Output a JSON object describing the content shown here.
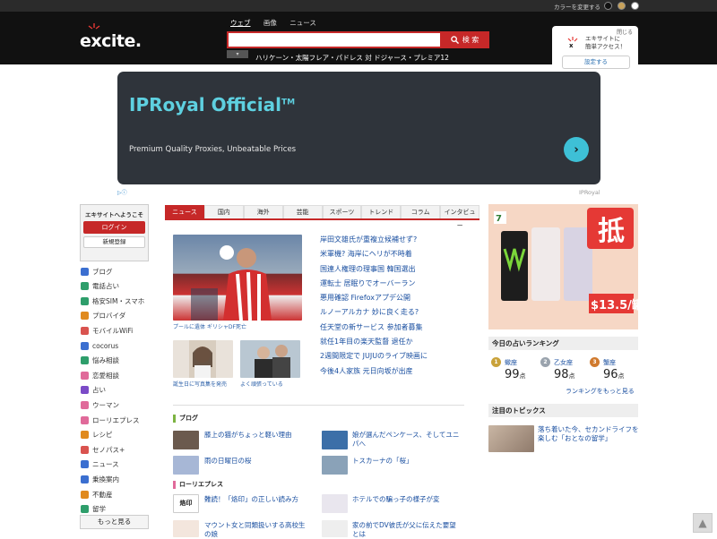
{
  "topbar": {
    "color_label": "カラーを変更する"
  },
  "header": {
    "logo": "excite.",
    "tabs": [
      "ウェブ",
      "画像",
      "ニュース"
    ],
    "search_value": "",
    "search_button": "検 索",
    "trending": "ハリケーン・太陽フレア・パドレス 対 ドジャース・プレミア12"
  },
  "promo": {
    "close": "閉じる",
    "line1": "エキサイトに",
    "line2": "簡単アクセス！",
    "button": "設定する"
  },
  "ad": {
    "title": "IPRoyal Official",
    "tm": "TM",
    "subtitle": "Premium Quality Proxies, Unbeatable Prices",
    "brand": "IPRoyal"
  },
  "sidebar": {
    "welcome": "エキサイトへようこそ",
    "login": "ログイン",
    "register": "新規登録",
    "items": [
      {
        "label": "ブログ",
        "color": "#3b6fd0"
      },
      {
        "label": "電話占い",
        "color": "#2e9e6b"
      },
      {
        "label": "格安SIM・スマホ",
        "color": "#2e9e6b"
      },
      {
        "label": "プロバイダ",
        "color": "#e08a1e"
      },
      {
        "label": "モバイルWiFi",
        "color": "#d9534f"
      },
      {
        "label": "cocorus",
        "color": "#3b6fd0"
      },
      {
        "label": "悩み相談",
        "color": "#2e9e6b"
      },
      {
        "label": "恋愛相談",
        "color": "#e06a9a"
      },
      {
        "label": "占い",
        "color": "#7b4bc7"
      },
      {
        "label": "ウーマン",
        "color": "#e06a9a"
      },
      {
        "label": "ローリエプレス",
        "color": "#e06a9a"
      },
      {
        "label": "レシピ",
        "color": "#e08a1e"
      },
      {
        "label": "セノパス+",
        "color": "#d9534f"
      },
      {
        "label": "ニュース",
        "color": "#3b6fd0"
      },
      {
        "label": "乗換案内",
        "color": "#3b6fd0"
      },
      {
        "label": "不動産",
        "color": "#e08a1e"
      },
      {
        "label": "留学",
        "color": "#2e9e6b"
      }
    ],
    "more": "もっと見る"
  },
  "news": {
    "categories": [
      "ニュース",
      "国内",
      "海外",
      "芸能",
      "スポーツ",
      "トレンド",
      "コラム",
      "インタビュー"
    ],
    "main_caption": "プールに遺体 ギリシャDF死亡",
    "sub_caption1": "誕生日に写真集を発売",
    "sub_caption2": "よく頑張っている",
    "headlines": [
      "岸田文雄氏が重複立候補せず?",
      "米軍機? 海岸にヘリが不時着",
      "国連人権理の理事国 韓国選出",
      "運転士 居眠りでオーバーラン",
      "悪用確認 Firefoxアプデ公開",
      "ルノーアルカナ 妙に良く走る?",
      "任天堂の新サービス 参加者募集",
      "就任1年目の楽天監督 退任か",
      "2週間限定で JUJUのライブ映画に",
      "今後4人家族 元日向坂が出産"
    ]
  },
  "blog": {
    "title": "ブログ",
    "items": [
      "膝上の猫がちょっと軽い理由",
      "娘が選んだペンケース、そしてユニパへ",
      "雨の日曜日の桜",
      "トスカーナの「桜」"
    ]
  },
  "laurier": {
    "title": "ローリエプレス",
    "items": [
      "難読！「烙印」の正しい読み方",
      "ホテルでの騙っ子の様子が変",
      "マウント女と同類扱いする高校生の娘",
      "家の前でDV彼氏が父に伝えた要望とは"
    ],
    "thumb_text": "烙印"
  },
  "right": {
    "ad_price": "$13.5/罐",
    "ad_big": "抵",
    "ranking_title": "今日の占いランキング",
    "ranking": [
      {
        "sign": "蠍座",
        "score": "99",
        "unit": "点",
        "rank": "1",
        "color": "#c9a23a"
      },
      {
        "sign": "乙女座",
        "score": "98",
        "unit": "点",
        "rank": "2",
        "color": "#9aa3ad"
      },
      {
        "sign": "蟹座",
        "score": "96",
        "unit": "点",
        "rank": "3",
        "color": "#d07a2e"
      }
    ],
    "ranking_more": "ランキングをもっと見る",
    "topics_title": "注目のトピックス",
    "topic_text": "落ち着いた今、セカンドライフを楽しむ「おとなの留学」"
  }
}
